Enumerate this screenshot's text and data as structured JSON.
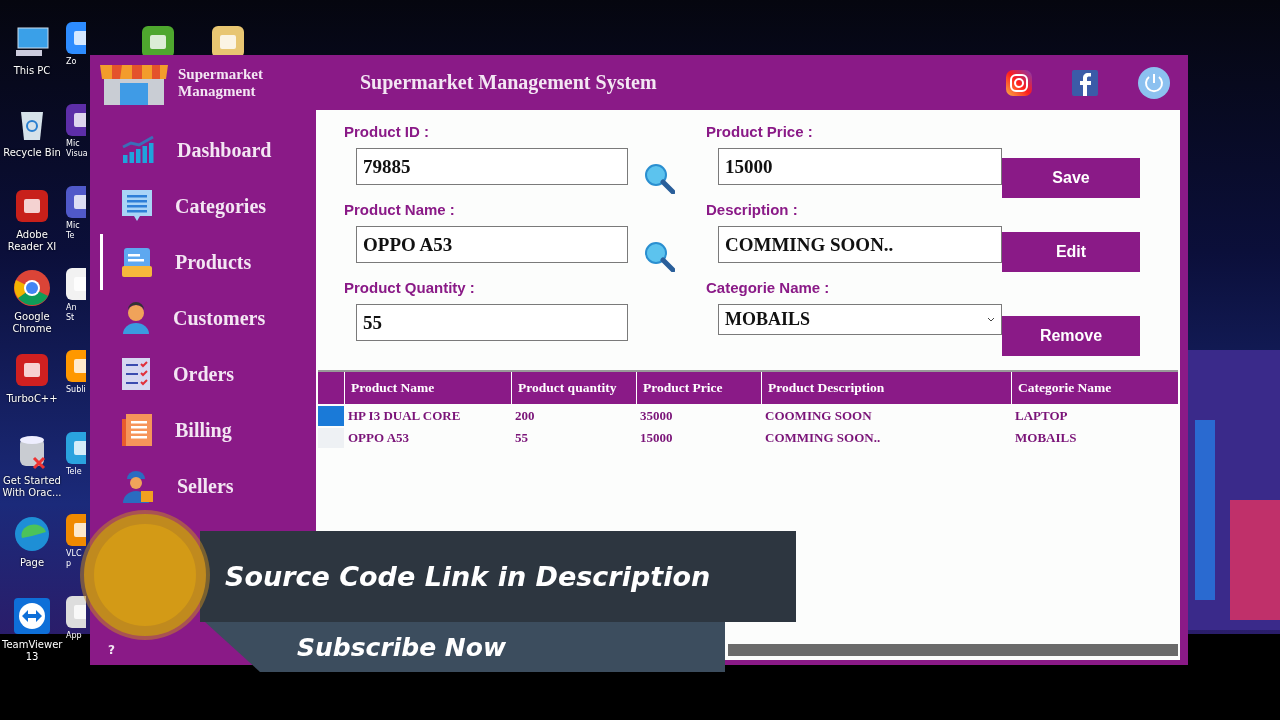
{
  "desktop": {
    "icons": [
      {
        "label": "This PC",
        "kind": "pc"
      },
      {
        "label": "Recycle Bin",
        "kind": "recycle"
      },
      {
        "label": "Adobe Reader XI",
        "kind": "adobe"
      },
      {
        "label": "Google Chrome",
        "kind": "chrome"
      },
      {
        "label": "TurboC++",
        "kind": "turbo"
      },
      {
        "label": "Get Started With Orac...",
        "kind": "oracle"
      },
      {
        "label": "Page",
        "kind": "edge"
      },
      {
        "label": "TeamViewer 13",
        "kind": "teamviewer"
      }
    ],
    "partial_icons": [
      {
        "label": "Zo",
        "kind": "zoom"
      },
      {
        "label": "Mic Visua",
        "kind": "vs"
      },
      {
        "label": "Mic Te",
        "kind": "teams"
      },
      {
        "label": "An St",
        "kind": "android"
      },
      {
        "label": "Subli",
        "kind": "sublime"
      },
      {
        "label": "Tele",
        "kind": "telegram"
      },
      {
        "label": "VLC p",
        "kind": "vlc"
      },
      {
        "label": "App",
        "kind": "appinstaller"
      }
    ],
    "top_icons": [
      {
        "kind": "camtasia"
      },
      {
        "kind": "zip"
      }
    ]
  },
  "window": {
    "brand": "Supermarket Managment",
    "title": "Supermarket Management System"
  },
  "sidebar": {
    "items": [
      {
        "label": "Dashboard",
        "kind": "dashboard",
        "selected": false
      },
      {
        "label": "Categories",
        "kind": "categories",
        "selected": false
      },
      {
        "label": "Products",
        "kind": "products",
        "selected": true
      },
      {
        "label": "Customers",
        "kind": "customers",
        "selected": false
      },
      {
        "label": "Orders",
        "kind": "orders",
        "selected": false
      },
      {
        "label": "Billing",
        "kind": "billing",
        "selected": false
      },
      {
        "label": "Sellers",
        "kind": "sellers",
        "selected": false
      }
    ],
    "help": "?"
  },
  "form": {
    "fields": [
      {
        "label": "Product ID :",
        "value": "79885",
        "kind": "search"
      },
      {
        "label": "Product Price :",
        "value": "15000",
        "kind": "text"
      },
      {
        "label": "Product Name :",
        "value": "OPPO A53",
        "kind": "search"
      },
      {
        "label": "Description  :",
        "value": "COMMING SOON..",
        "kind": "text"
      },
      {
        "label": "Product Quantity :",
        "value": "55",
        "kind": "text"
      },
      {
        "label": "Categorie Name :",
        "value": "MOBAILS",
        "kind": "select"
      }
    ],
    "buttons": [
      "Save",
      "Edit",
      "Remove"
    ]
  },
  "table": {
    "columns": [
      "Product Name",
      "Product quantity",
      "Product Price",
      "Product Description",
      "Categorie Name"
    ],
    "rows": [
      {
        "cells": [
          "HP I3 DUAL CORE",
          "200",
          "35000",
          "COOMING SOON",
          "LAPTOP"
        ],
        "selected": true
      },
      {
        "cells": [
          "OPPO A53",
          "55",
          "15000",
          "COMMING SOON..",
          "MOBAILS"
        ],
        "selected": false
      }
    ]
  },
  "overlay": {
    "headline": "Source Code Link in Description",
    "subline": "Subscribe Now"
  }
}
